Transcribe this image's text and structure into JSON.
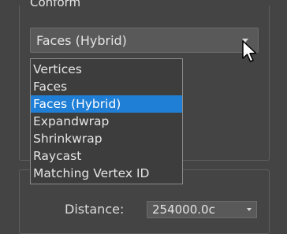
{
  "group": {
    "title": "Conform"
  },
  "combo": {
    "selected_value": "Faces (Hybrid)"
  },
  "dropdown": {
    "items": [
      {
        "label": "Vertices",
        "selected": false
      },
      {
        "label": "Faces",
        "selected": false
      },
      {
        "label": "Faces (Hybrid)",
        "selected": true
      },
      {
        "label": "Expandwrap",
        "selected": false
      },
      {
        "label": "Shrinkwrap",
        "selected": false
      },
      {
        "label": "Raycast",
        "selected": false
      },
      {
        "label": "Matching Vertex ID",
        "selected": false
      }
    ]
  },
  "distance": {
    "label": "Distance:",
    "value": "254000.0c"
  },
  "colors": {
    "background": "#444444",
    "selection": "#1f7fd6",
    "dropdown_background": "#3d3d3d"
  },
  "icons": {
    "combo_arrow": "chevron-down-icon",
    "spinner_arrow": "chevron-down-icon",
    "cursor": "mouse-pointer-icon"
  }
}
